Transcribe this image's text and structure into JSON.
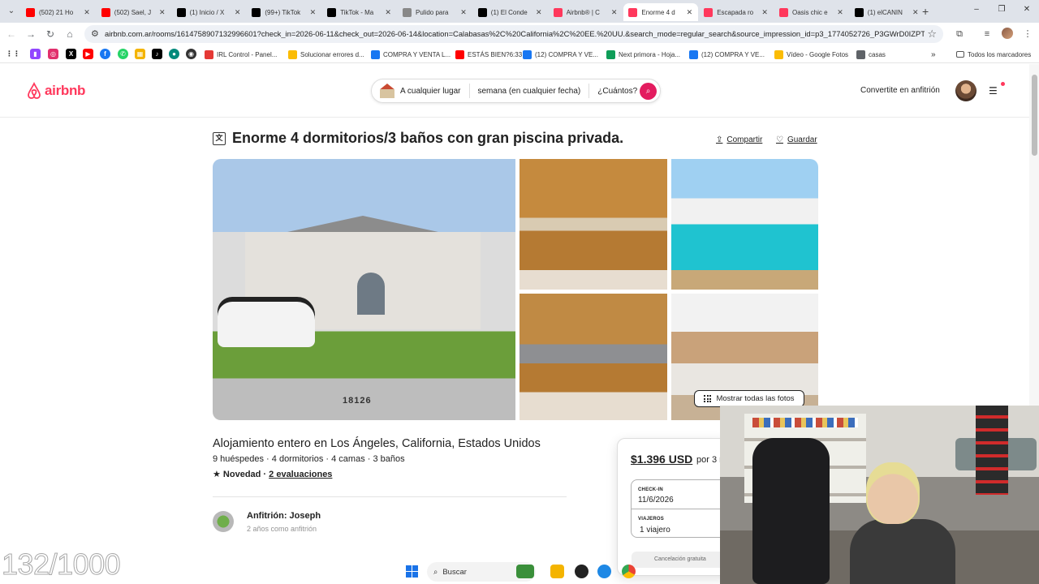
{
  "browser": {
    "tabs": [
      {
        "title": "(502) 21 Ho",
        "icon": "youtube-icon",
        "color": "#ff0000",
        "active": false
      },
      {
        "title": "(502) Sael, J",
        "icon": "youtube-icon",
        "color": "#ff0000",
        "active": false
      },
      {
        "title": "(1) Inicio / X",
        "icon": "x-icon",
        "color": "#000000",
        "active": false
      },
      {
        "title": "(99+) TikTok",
        "icon": "tiktok-icon",
        "color": "#000000",
        "active": false
      },
      {
        "title": "TikTok - Ma",
        "icon": "tiktok-icon",
        "color": "#000000",
        "active": false
      },
      {
        "title": "Pulido para",
        "icon": "page-icon",
        "color": "#888888",
        "active": false
      },
      {
        "title": "(1) El Conde",
        "icon": "x-icon",
        "color": "#000000",
        "active": false
      },
      {
        "title": "Airbnb® | C",
        "icon": "airbnb-icon",
        "color": "#ff385c",
        "active": false
      },
      {
        "title": "Enorme 4 d",
        "icon": "airbnb-icon",
        "color": "#ff385c",
        "active": true
      },
      {
        "title": "Escapada ro",
        "icon": "airbnb-icon",
        "color": "#ff385c",
        "active": false
      },
      {
        "title": "Oasis chic e",
        "icon": "airbnb-icon",
        "color": "#ff385c",
        "active": false
      },
      {
        "title": "(1) elCANIN",
        "icon": "x-icon",
        "color": "#000000",
        "active": false
      }
    ],
    "url": "airbnb.com.ar/rooms/1614758907132996601?check_in=2026-06-11&check_out=2026-06-14&location=Calabasas%2C%20California%2C%20EE.%20UU.&search_mode=regular_search&source_impression_id=p3_1774052726_P3GWrD0IZPTQe3...",
    "bookmarks": [
      {
        "label": "IRL Control - Panel...",
        "color": "#e53935"
      },
      {
        "label": "Solucionar errores d...",
        "color": "#fbbc04"
      },
      {
        "label": "COMPRA Y VENTA L...",
        "color": "#1877f2"
      },
      {
        "label": "ESTÁS BIEN?6:33",
        "color": "#ff0000"
      },
      {
        "label": "(12) COMPRA Y VE...",
        "color": "#1877f2"
      },
      {
        "label": "Next primora - Hoja...",
        "color": "#0f9d58"
      },
      {
        "label": "(12) COMPRA Y VE...",
        "color": "#1877f2"
      },
      {
        "label": "Vídeo - Google Fotos",
        "color": "#fbbc04"
      },
      {
        "label": "casas",
        "color": "#5f6368"
      }
    ],
    "all_bookmarks": "Todos los marcadores"
  },
  "header": {
    "logo": "airbnb",
    "search_where": "A cualquier lugar",
    "search_when": "semana (en cualquier fecha)",
    "search_who": "¿Cuántos?",
    "host_link": "Convertite en anfitrión"
  },
  "listing": {
    "title": "Enorme 4 dormitorios/3 baños con gran piscina privada.",
    "share": "Compartir",
    "save": "Guardar",
    "show_all_photos": "Mostrar todas las fotos",
    "subtitle": "Alojamiento entero en Los Ángeles, California, Estados Unidos",
    "details": "9 huéspedes · 4 dormitorios · 4 camas · 3 baños",
    "rating_badge": "★ Novedad",
    "rating_sep": " · ",
    "reviews": "2 evaluaciones",
    "host_name": "Anfitrión: Joseph",
    "host_meta": "2 años como anfitrión",
    "house_number": "18126"
  },
  "booking": {
    "price": "$1.396 USD",
    "per": "por 3 n",
    "checkin_label": "CHECK-IN",
    "checkin_value": "11/6/2026",
    "guests_label": "VIAJEROS",
    "guests_value": "1 viajero",
    "cta_partial": "Cancelación gratuita"
  },
  "overlay": {
    "counter": "132/1000"
  },
  "taskbar": {
    "search": "Buscar"
  }
}
